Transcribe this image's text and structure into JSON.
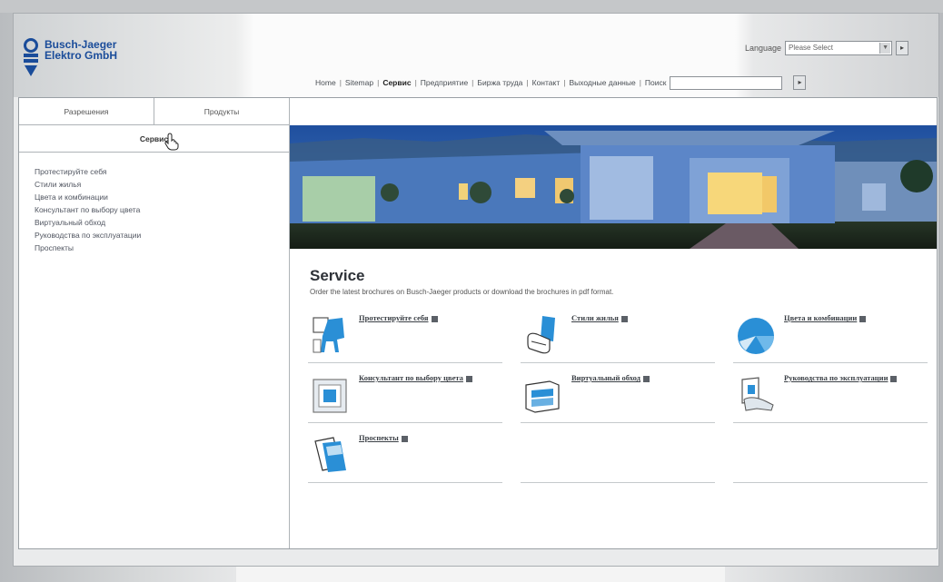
{
  "brand": {
    "line1": "Busch-Jaeger",
    "line2": "Elektro GmbH"
  },
  "language": {
    "label": "Language",
    "selected": "Please Select",
    "go": "▸"
  },
  "topnav": {
    "items": [
      "Home",
      "Sitemap",
      "Сервис",
      "Предприятие",
      "Биржа труда",
      "Контакт",
      "Выходные данные",
      "Поиск"
    ],
    "active_index": 2,
    "go": "▸"
  },
  "sidebar": {
    "tabs": [
      "Разрешения",
      "Продукты"
    ],
    "selected": "Сервис",
    "items": [
      "Протестируйте себя",
      "Стили жилья",
      "Цвета и комбинации",
      "Консультант по выбору цвета",
      "Виртуальный обход",
      "Руководства по эксплуатации",
      "Проспекты"
    ]
  },
  "service": {
    "title": "Service",
    "description": "Order the latest brochures on Busch-Jaeger products or download the brochures in pdf format.",
    "cards": [
      {
        "label": "Протестируйте себя",
        "icon": "chair-icon"
      },
      {
        "label": "Стили жилья",
        "icon": "armchair-icon"
      },
      {
        "label": "Цвета и комбинации",
        "icon": "color-disc-icon"
      },
      {
        "label": "Консультант по выбору цвета",
        "icon": "switch-frame-icon"
      },
      {
        "label": "Виртуальный обход",
        "icon": "room-icon"
      },
      {
        "label": "Руководства по эксплуатации",
        "icon": "hand-switch-icon"
      },
      {
        "label": "Проспекты",
        "icon": "brochure-icon"
      }
    ]
  },
  "colors": {
    "brand_blue": "#1a4c9a",
    "icon_blue": "#2a8fd6"
  }
}
